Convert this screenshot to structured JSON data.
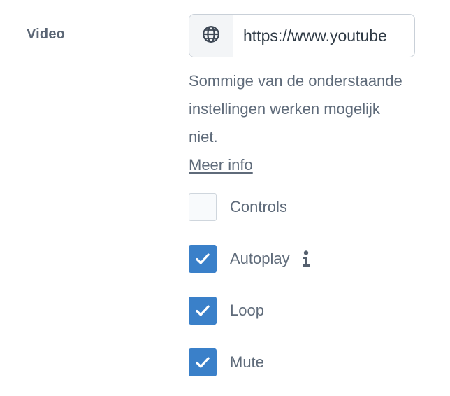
{
  "field": {
    "label": "Video"
  },
  "url": {
    "prefix_icon": "globe-icon",
    "value": "https://www.youtube"
  },
  "help": {
    "text": "Sommige van de onderstaande instellingen werken mogelijk niet.",
    "link": "Meer info"
  },
  "options": [
    {
      "label": "Controls",
      "checked": false
    },
    {
      "label": "Autoplay",
      "checked": true,
      "info_icon": "info-icon"
    },
    {
      "label": "Loop",
      "checked": true
    },
    {
      "label": "Mute",
      "checked": true
    }
  ],
  "colors": {
    "checkbox_checked": "#3a80c9",
    "text": "#5f6b7a",
    "border": "#c9d0d8"
  }
}
